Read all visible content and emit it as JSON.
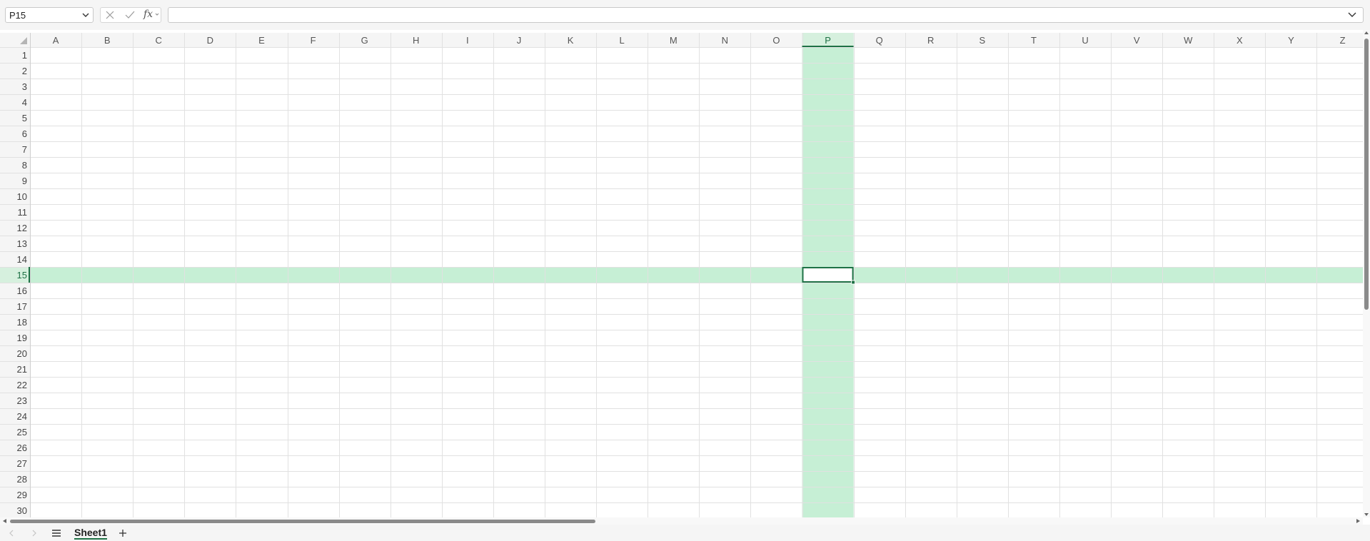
{
  "name_box": {
    "value": "P15"
  },
  "formula_bar": {
    "fx_label": "fx",
    "value": ""
  },
  "grid": {
    "columns": [
      "A",
      "B",
      "C",
      "D",
      "E",
      "F",
      "G",
      "H",
      "I",
      "J",
      "K",
      "L",
      "M",
      "N",
      "O",
      "P",
      "Q",
      "R",
      "S",
      "T",
      "U",
      "V",
      "W",
      "X",
      "Y",
      "Z"
    ],
    "rows": [
      "1",
      "2",
      "3",
      "4",
      "5",
      "6",
      "7",
      "8",
      "9",
      "10",
      "11",
      "12",
      "13",
      "14",
      "15",
      "16",
      "17",
      "18",
      "19",
      "20",
      "21",
      "22",
      "23",
      "24",
      "25",
      "26",
      "27",
      "28",
      "29",
      "30"
    ],
    "selected_column": "P",
    "selected_row": "15",
    "active_cell_value": ""
  },
  "sheet_tabs": {
    "active": "Sheet1",
    "items": [
      "Sheet1"
    ]
  },
  "icons": {
    "name_box_caret": "chevron-down-icon",
    "cancel": "x-icon",
    "enter": "check-icon",
    "function": "fx-icon",
    "formula_expand": "chevron-down-icon",
    "prev_sheet": "chevron-left-icon",
    "next_sheet": "chevron-right-icon",
    "all_sheets": "menu-icon",
    "add_sheet": "plus-icon"
  },
  "colors": {
    "accent": "#1e7145",
    "selection_fill": "#c6efd5",
    "gridline": "#e1e1e1",
    "header_bg": "#f5f5f5",
    "header_text": "#555555"
  }
}
